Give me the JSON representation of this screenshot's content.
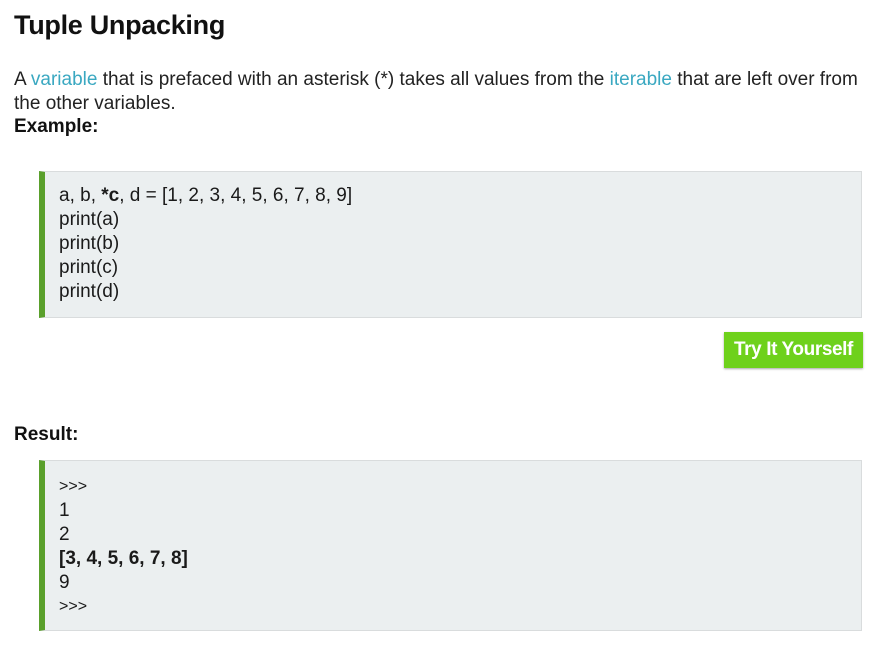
{
  "heading": "Tuple Unpacking",
  "intro": {
    "part1": "A ",
    "link1": "variable",
    "part2": " that is prefaced with an asterisk (*) takes all values from the ",
    "link2": "iterable",
    "part3": " that are left over from the other variables."
  },
  "example_label": "Example:",
  "example_code": {
    "line1_a": "a, b, ",
    "line1_bold": "*c",
    "line1_b": ", d = [1, 2, 3, 4, 5, 6, 7, 8, 9]",
    "line2": "print(a)",
    "line3": "print(b)",
    "line4": "print(c)",
    "line5": "print(d)"
  },
  "try_button_label": "Try It Yourself",
  "result_label": "Result:",
  "result_output": {
    "prompt_start": ">>>",
    "line1": "1",
    "line2": "2",
    "line3": "[3, 4, 5, 6, 7, 8]",
    "line4": "9",
    "prompt_end": ">>>"
  },
  "colors": {
    "link": "#3aa8c1",
    "code_border": "#5aa02c",
    "code_background": "#ebeff0",
    "button": "#6ed11b"
  }
}
